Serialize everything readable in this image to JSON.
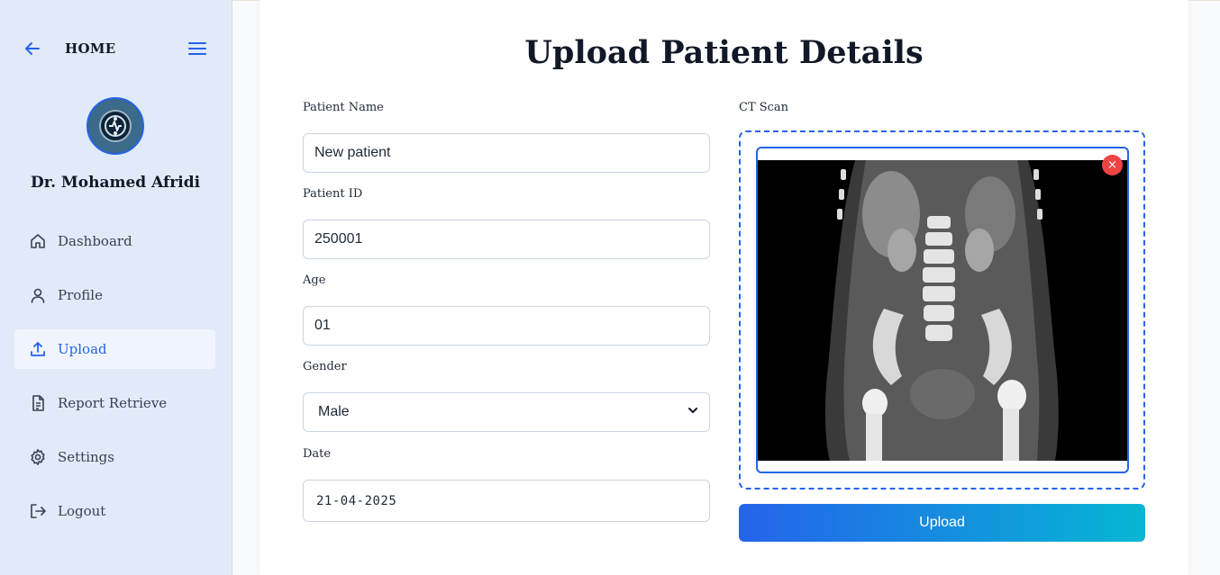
{
  "sidebar": {
    "home_label": "HOME",
    "doctor_name": "Dr. Mohamed Afridi",
    "items": [
      {
        "label": "Dashboard",
        "icon": "home-icon"
      },
      {
        "label": "Profile",
        "icon": "user-icon"
      },
      {
        "label": "Upload",
        "icon": "upload-icon",
        "active": true
      },
      {
        "label": "Report Retrieve",
        "icon": "file-text-icon"
      },
      {
        "label": "Settings",
        "icon": "gear-icon"
      },
      {
        "label": "Logout",
        "icon": "logout-icon"
      }
    ]
  },
  "main": {
    "title": "Upload Patient Details",
    "form": {
      "patient_name_label": "Patient Name",
      "patient_name_value": "New patient",
      "patient_id_label": "Patient ID",
      "patient_id_value": "250001",
      "age_label": "Age",
      "age_value": "01",
      "gender_label": "Gender",
      "gender_value": "Male",
      "date_label": "Date",
      "date_value": "21-04-2025"
    },
    "ct_scan_label": "CT Scan",
    "remove_symbol": "×",
    "upload_button": "Upload"
  },
  "colors": {
    "accent": "#2563eb",
    "gradient_end": "#06b6d4",
    "remove": "#ef4444",
    "sidebar_bg": "#e0eaf8"
  }
}
